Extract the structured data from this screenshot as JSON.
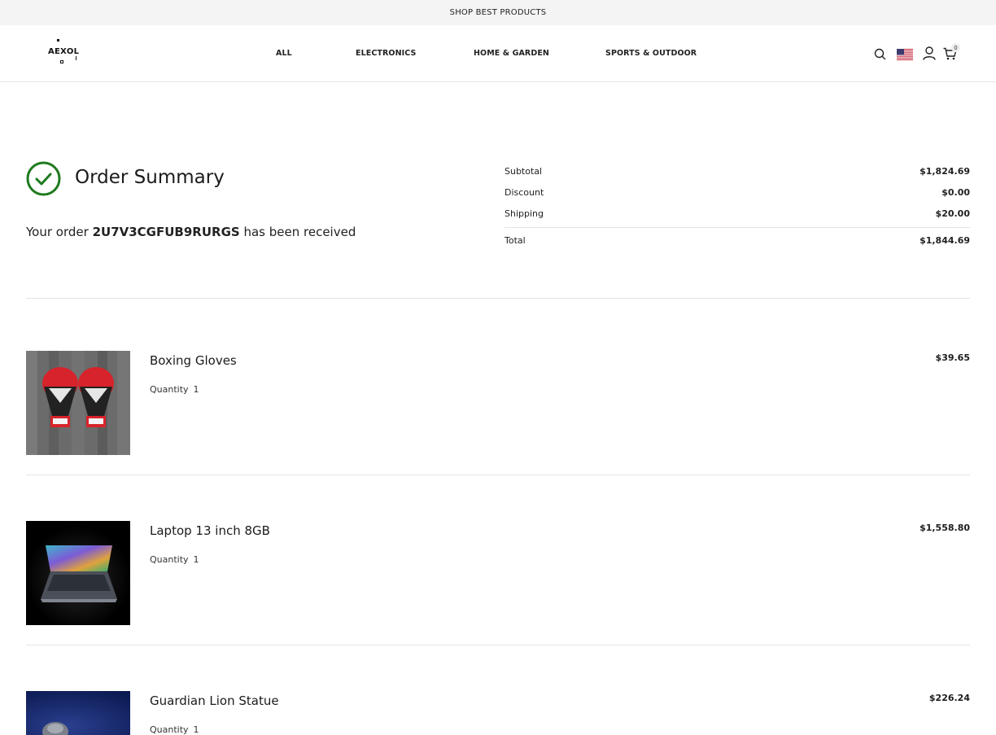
{
  "announcement": "SHOP BEST PRODUCTS",
  "header": {
    "logo_text": "AEXOL",
    "nav": [
      "ALL",
      "ELECTRONICS",
      "HOME & GARDEN",
      "SPORTS & OUTDOOR"
    ],
    "cart_count": "0",
    "icons": [
      "search-icon",
      "us-flag-icon",
      "user-icon",
      "cart-icon"
    ]
  },
  "summary": {
    "title": "Order Summary",
    "order_prefix": "Your order",
    "order_code": "2U7V3CGFUB9RURGS",
    "order_suffix": "has been received"
  },
  "totals": {
    "subtotal_label": "Subtotal",
    "subtotal": "$1,824.69",
    "discount_label": "Discount",
    "discount": "$0.00",
    "shipping_label": "Shipping",
    "shipping": "$20.00",
    "total_label": "Total",
    "total": "$1,844.69"
  },
  "items": [
    {
      "name": "Boxing Gloves",
      "qty_label": "Quantity",
      "qty": "1",
      "price": "$39.65"
    },
    {
      "name": "Laptop 13 inch 8GB",
      "qty_label": "Quantity",
      "qty": "1",
      "price": "$1,558.80"
    },
    {
      "name": "Guardian Lion Statue",
      "qty_label": "Quantity",
      "qty": "1",
      "price": "$226.24"
    }
  ],
  "colors": {
    "success": "#1e7a1e",
    "announce_bg": "#f4f4f4",
    "divider": "#e3e3e3"
  }
}
